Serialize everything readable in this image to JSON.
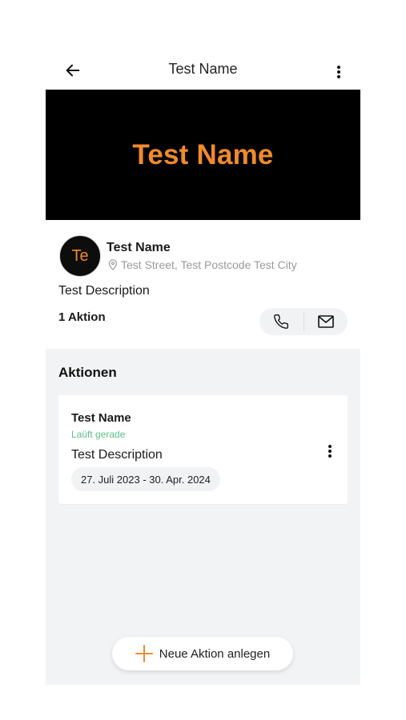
{
  "appbar": {
    "title": "Test Name",
    "back_icon": "arrow-left-icon",
    "menu_icon": "more-vertical-icon"
  },
  "banner": {
    "title": "Test Name",
    "background_color": "#000000",
    "text_color": "#f08a2c"
  },
  "profile": {
    "avatar_initials": "Te",
    "name": "Test Name",
    "address": "Test Street, Test Postcode Test City",
    "address_icon": "map-pin-icon",
    "description": "Test Description",
    "action_count": "1 Aktion",
    "phone_icon": "phone-icon",
    "email_icon": "mail-icon"
  },
  "actions": {
    "section_title": "Aktionen",
    "items": [
      {
        "name": "Test Name",
        "status": "Laüft gerade",
        "status_color": "#5cc08a",
        "description": "Test Description",
        "date_range": "27. Juli 2023 - 30. Apr. 2024"
      }
    ],
    "fab_label": "Neue Aktion anlegen",
    "fab_icon": "plus-icon",
    "accent_color": "#f08a2c"
  }
}
